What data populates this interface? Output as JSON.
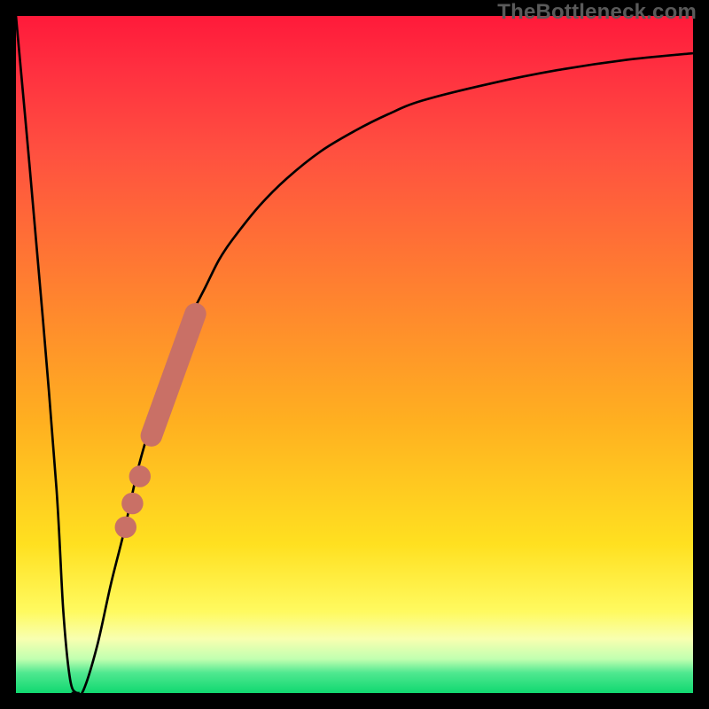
{
  "attribution": "TheBottleneck.com",
  "colors": {
    "curve_stroke": "#000000",
    "marker_fill": "#c97066",
    "frame": "#000000"
  },
  "chart_data": {
    "type": "line",
    "title": "",
    "xlabel": "",
    "ylabel": "",
    "xlim": [
      0,
      100
    ],
    "ylim": [
      0,
      100
    ],
    "x": [
      0,
      2,
      4,
      6,
      7,
      8,
      9,
      10,
      12,
      14,
      16,
      18,
      20,
      22,
      24,
      26,
      28,
      30,
      32,
      36,
      40,
      45,
      50,
      55,
      60,
      70,
      80,
      90,
      100
    ],
    "y": [
      100,
      78,
      55,
      30,
      12,
      2,
      0,
      0.5,
      7,
      16,
      24,
      33,
      40,
      46,
      51,
      56,
      60,
      64,
      67,
      72,
      76,
      80,
      83,
      85.5,
      87.5,
      90,
      92,
      93.5,
      94.5
    ],
    "valley_flat": {
      "x_start": 8.2,
      "x_end": 9.4,
      "y": 0
    },
    "markers": {
      "type": "segment_with_dots",
      "segment": {
        "x_start": 20,
        "y_start": 38,
        "x_end": 26.5,
        "y_end": 56
      },
      "dots": [
        {
          "x": 18.3,
          "y": 32
        },
        {
          "x": 17.2,
          "y": 28
        },
        {
          "x": 16.2,
          "y": 24.5
        }
      ],
      "radius": 1.6
    }
  }
}
